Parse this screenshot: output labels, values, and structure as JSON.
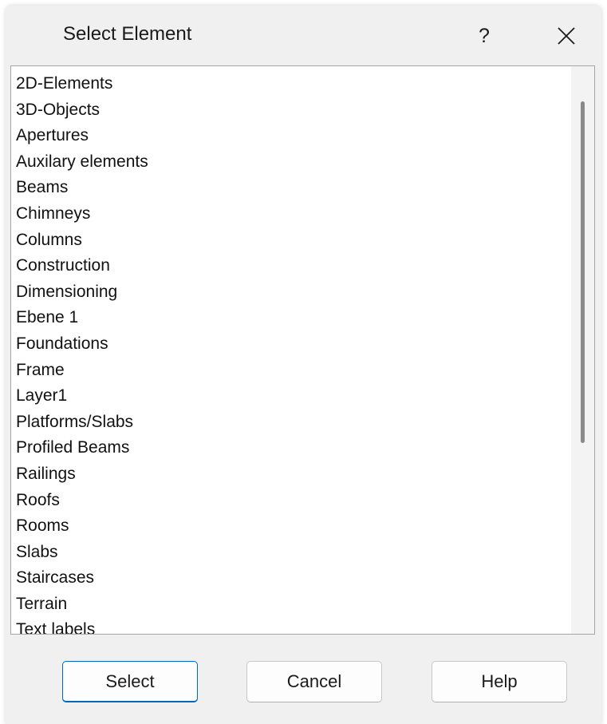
{
  "dialog": {
    "title": "Select Element",
    "help_glyph": "?",
    "close_icon": "close-icon"
  },
  "list": {
    "items": [
      "2D-Elements",
      "3D-Objects",
      "Apertures",
      "Auxilary elements",
      "Beams",
      "Chimneys",
      "Columns",
      "Construction",
      "Dimensioning",
      "Ebene 1",
      "Foundations",
      "Frame",
      "Layer1",
      "Platforms/Slabs",
      "Profiled Beams",
      "Railings",
      "Roofs",
      "Rooms",
      "Slabs",
      "Staircases",
      "Terrain",
      "Text labels"
    ]
  },
  "buttons": {
    "select_label": "Select",
    "cancel_label": "Cancel",
    "help_label": "Help"
  },
  "colors": {
    "accent": "#0067c0",
    "dialog_background": "#f0f0f0"
  }
}
